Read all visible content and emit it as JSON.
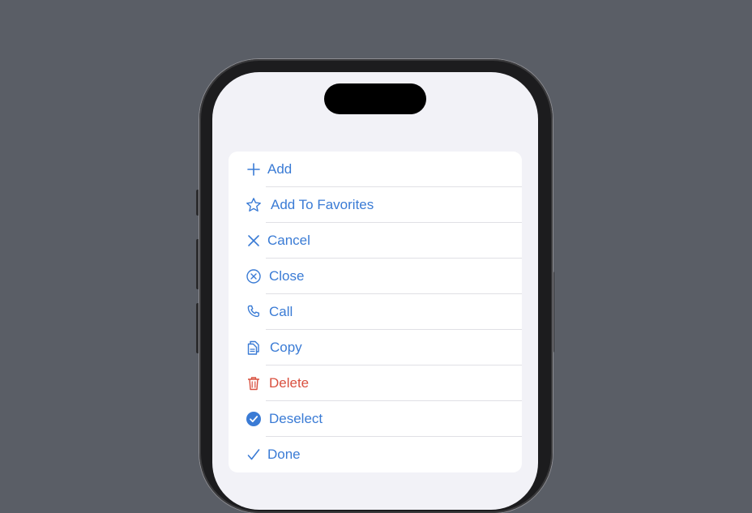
{
  "actions": [
    {
      "label": "Add",
      "icon": "plus-icon",
      "role": "normal"
    },
    {
      "label": "Add To Favorites",
      "icon": "star-icon",
      "role": "normal"
    },
    {
      "label": "Cancel",
      "icon": "x-mark-icon",
      "role": "normal"
    },
    {
      "label": "Close",
      "icon": "x-circle-icon",
      "role": "normal"
    },
    {
      "label": "Call",
      "icon": "phone-icon",
      "role": "normal"
    },
    {
      "label": "Copy",
      "icon": "copy-icon",
      "role": "normal"
    },
    {
      "label": "Delete",
      "icon": "trash-icon",
      "role": "destructive"
    },
    {
      "label": "Deselect",
      "icon": "checkmark-circle-fill-icon",
      "role": "normal"
    },
    {
      "label": "Done",
      "icon": "checkmark-icon",
      "role": "normal"
    }
  ],
  "colors": {
    "tint": "#3a7bd5",
    "destructive": "#d9503f",
    "background": "#f2f2f7",
    "card": "#ffffff"
  }
}
